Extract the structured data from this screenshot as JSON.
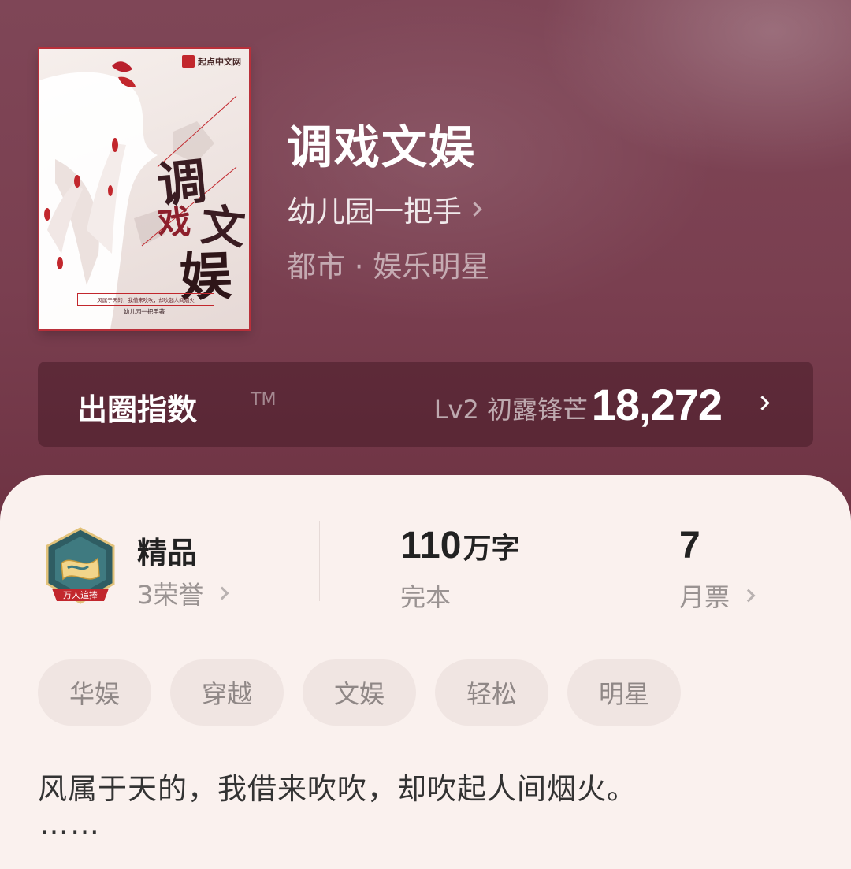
{
  "cover": {
    "brand": "起点中文网",
    "title_chars": [
      "调",
      "戏",
      "文",
      "娱"
    ],
    "slogan": "风属于天的，我借来吹吹，却吹起人间烟火",
    "author": "幼儿园一把手著"
  },
  "book": {
    "title": "调戏文娱",
    "author": "幼儿园一把手",
    "genre": "都市 · 娱乐明星"
  },
  "index_bar": {
    "label": "出圈指数",
    "tm": "TM",
    "level": "Lv2 初露锋芒",
    "value": "18,272"
  },
  "stats": {
    "tier": "精品",
    "badge_text": "万人追捧",
    "honors": "3荣誉",
    "word_count_num": "110",
    "word_count_unit": "万字",
    "status": "完本",
    "monthly_tickets": "7",
    "monthly_tickets_label": "月票"
  },
  "tags": [
    "华娱",
    "穿越",
    "文娱",
    "轻松",
    "明星"
  ],
  "synopsis": {
    "text": "风属于天的，我借来吹吹，却吹起人间烟火。",
    "more": "……"
  },
  "colors": {
    "hero_bg": "#7d3f4f",
    "card_bg": "#faf1ee",
    "tag_bg": "#f0e5e2",
    "accent_red": "#c2272d"
  }
}
